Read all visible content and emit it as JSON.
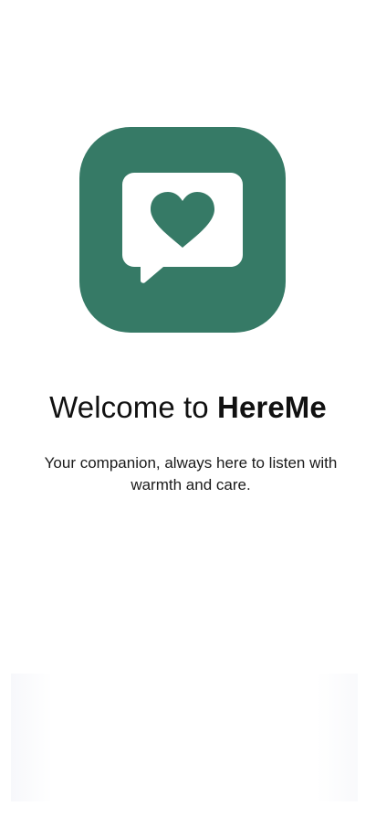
{
  "welcome": {
    "title_prefix": "Welcome to ",
    "title_brand": "HereMe",
    "tagline": "Your companion, always here to listen with warmth and care."
  },
  "colors": {
    "brand_green": "#367A66",
    "background": "#FFFFFF"
  },
  "icons": {
    "logo": "chat-bubble-heart-icon"
  }
}
